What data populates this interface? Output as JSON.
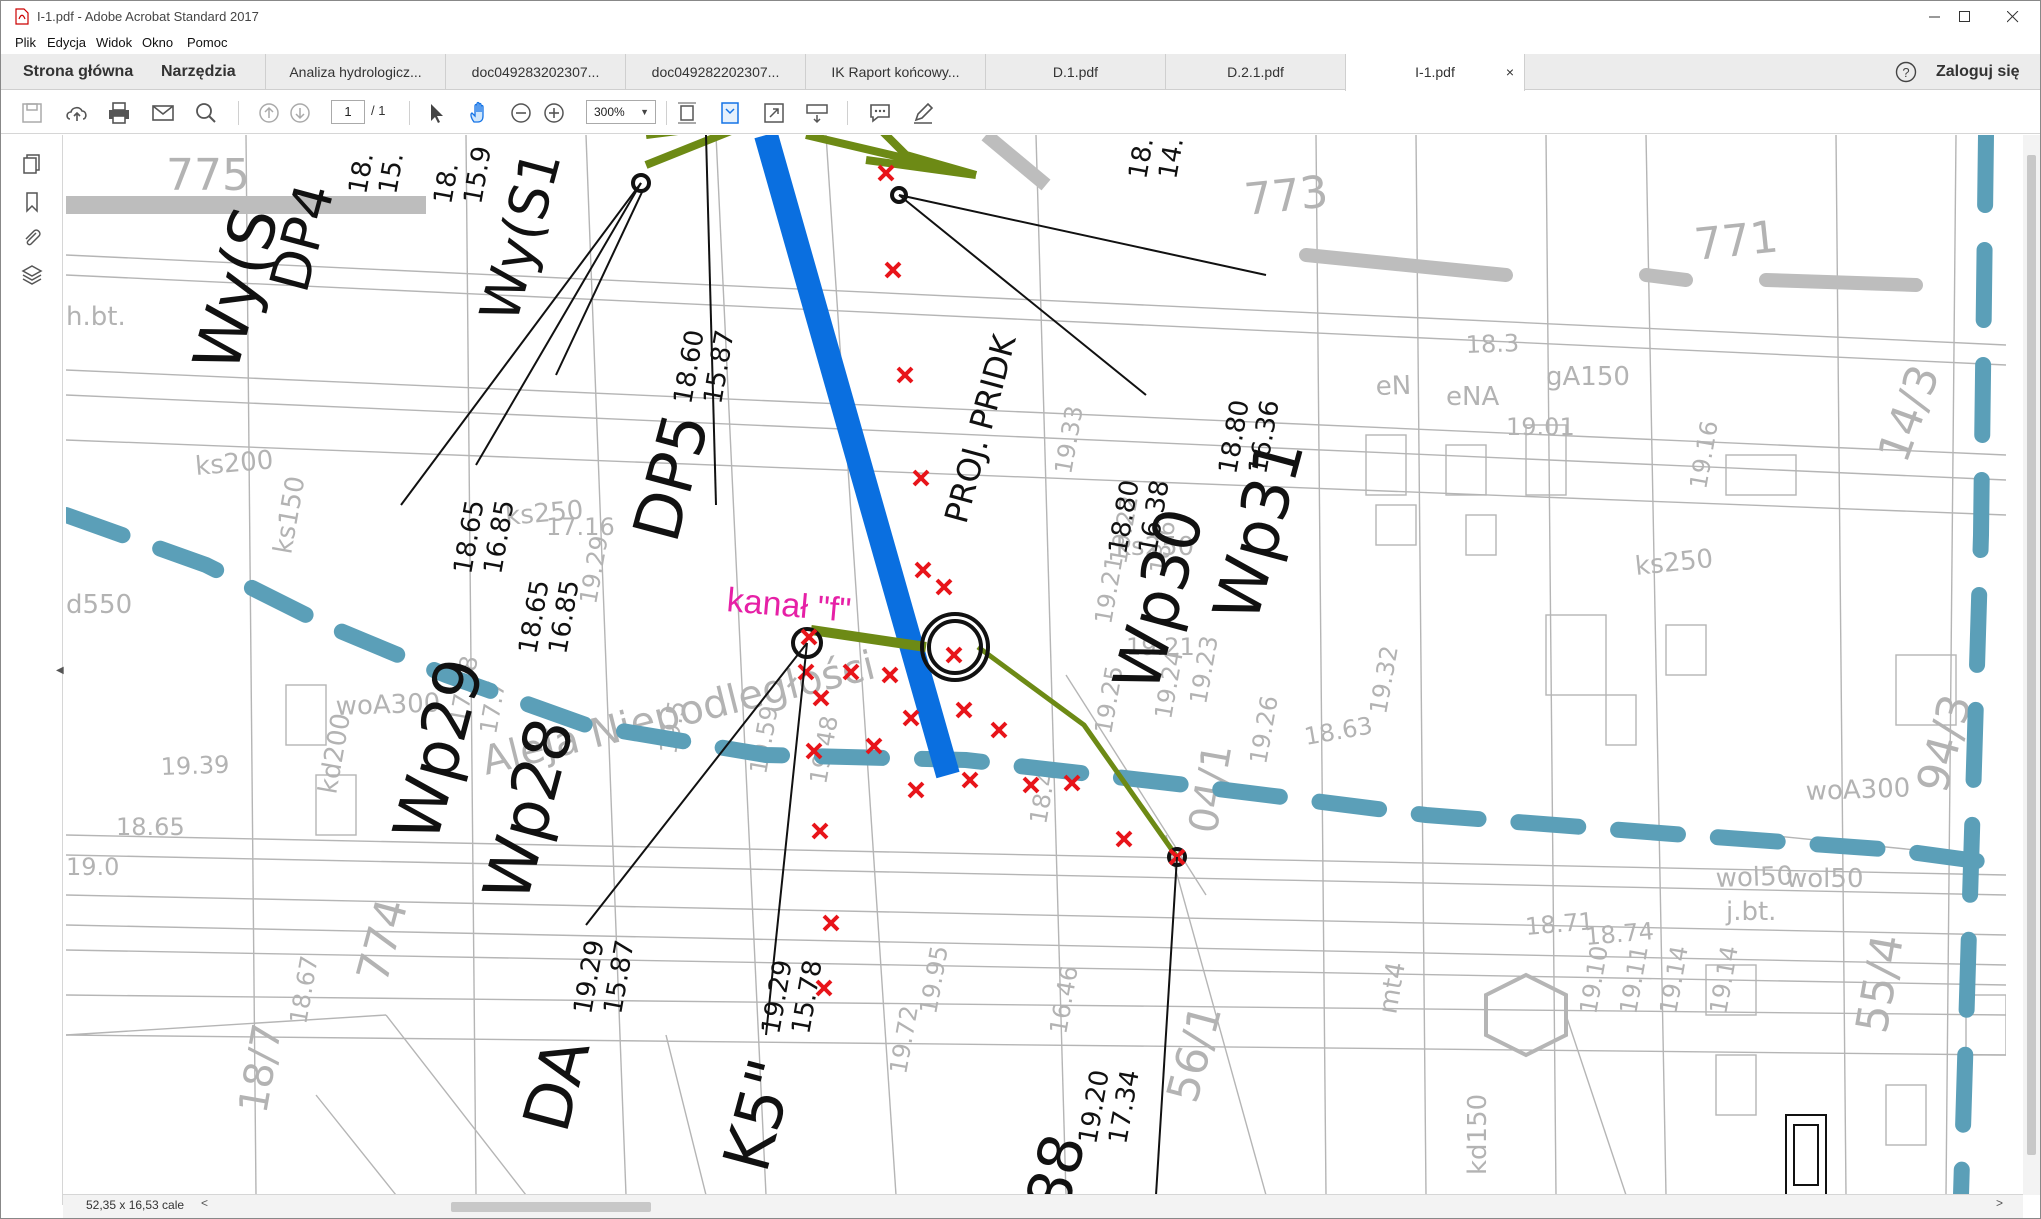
{
  "window": {
    "title": "I-1.pdf - Adobe Acrobat Standard 2017",
    "app_icon": "pdf-file-icon"
  },
  "menu": [
    "Plik",
    "Edycja",
    "Widok",
    "Okno",
    "Pomoc"
  ],
  "nav": {
    "home": "Strona główna",
    "tools": "Narzędzia",
    "help_icon": "help-icon",
    "signin": "Zaloguj się"
  },
  "tabs": [
    {
      "label": "Analiza hydrologicz..."
    },
    {
      "label": "doc049283202307..."
    },
    {
      "label": "doc049282202307..."
    },
    {
      "label": "IK Raport końcowy..."
    },
    {
      "label": "D.1.pdf"
    },
    {
      "label": "D.2.1.pdf"
    },
    {
      "label": "I-1.pdf",
      "active": true
    }
  ],
  "tab_close": "×",
  "toolbar": {
    "page_current": "1",
    "page_total": "/ 1",
    "zoom": "300%"
  },
  "status": {
    "dimensions": "52,35 x 16,53 cale"
  },
  "drawing": {
    "annotation_label": "kanał \"f\"",
    "parcel_numbers": [
      "775",
      "773",
      "771",
      "774",
      "14/3",
      "94/3",
      "56/1",
      "55/4",
      "18/7",
      "04/1"
    ],
    "pipe_labels": [
      {
        "name": "DP4",
        "top": "18.",
        "bottom": "15."
      },
      {
        "name": "Wy(S1",
        "top": "18.",
        "bottom": "15.9"
      },
      {
        "name": "Wy(S",
        "top": "",
        "bottom": ""
      },
      {
        "name": "DP5",
        "top": "18.60",
        "bottom": "15.87"
      },
      {
        "name": "Wp29",
        "top": "18.65",
        "bottom": "16.85"
      },
      {
        "name": "Wp28",
        "top": "18.65",
        "bottom": "16.85"
      },
      {
        "name": "Wp30",
        "top": "18.80",
        "bottom": "16.38"
      },
      {
        "name": "Wp31",
        "top": "18.80",
        "bottom": "16.36"
      },
      {
        "name": "DA",
        "top": "19.29",
        "bottom": "15.87"
      },
      {
        "name": "K5\"",
        "top": "19.29",
        "bottom": "15.78"
      },
      {
        "name": "88",
        "top": "19.20",
        "bottom": "17.34"
      },
      {
        "name": "",
        "top": "18.",
        "bottom": "14."
      }
    ],
    "project_label": "PROJ. PRIDK",
    "street_label": "Aleja Niepodległości",
    "utility_labels": [
      "ks200",
      "ks250",
      "ks250",
      "ks250",
      "ks150",
      "d550",
      "woA300",
      "woA300",
      "wol50",
      "wol50",
      "eN",
      "eNA",
      "gA150",
      "h.bt.",
      "j.bt.",
      "mt4",
      "kd150",
      "kd200"
    ],
    "spot_heights": [
      "19.01",
      "19.39",
      "18.65",
      "18.3",
      "19.29",
      "19.33",
      "19.25",
      "19.24",
      "19.21",
      "19.23",
      "19.32",
      "18.63",
      "19.16",
      "18.71",
      "18.74",
      "19.11",
      "19.14",
      "18.67",
      "17.48",
      "17.16",
      "17.7",
      "19.0",
      "18.4",
      "16.46",
      "19.72",
      "19.95",
      "19.48",
      "19.5",
      "19.59",
      "19.26",
      "19.21",
      "19.22",
      "18.6",
      "19.10",
      "19.14"
    ]
  }
}
